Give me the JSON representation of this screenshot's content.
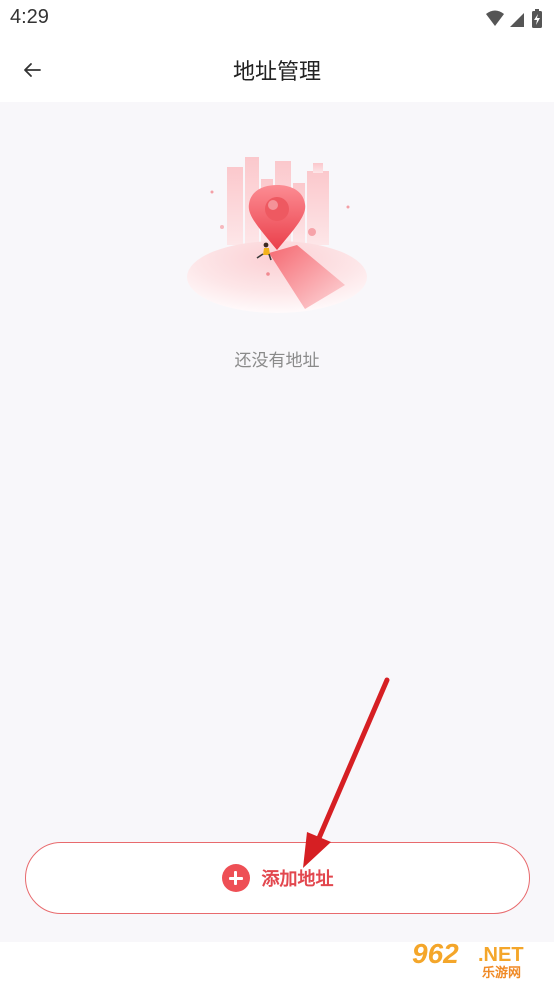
{
  "status_bar": {
    "time": "4:29",
    "icons": [
      "wifi-icon",
      "signal-icon",
      "battery-charging-icon"
    ]
  },
  "header": {
    "back_icon": "arrow-left-icon",
    "title": "地址管理"
  },
  "empty_state": {
    "illustration": "location-pin-illustration",
    "message": "还没有地址"
  },
  "add_button": {
    "icon": "plus-circle-icon",
    "label": "添加地址"
  },
  "watermark": {
    "main": "962",
    "suffix": ".NET",
    "sub": "乐游网"
  },
  "colors": {
    "accent": "#e2474e",
    "button_border": "#e86a6d",
    "background": "#f8f7fa",
    "annotation_arrow": "#d61f23"
  }
}
